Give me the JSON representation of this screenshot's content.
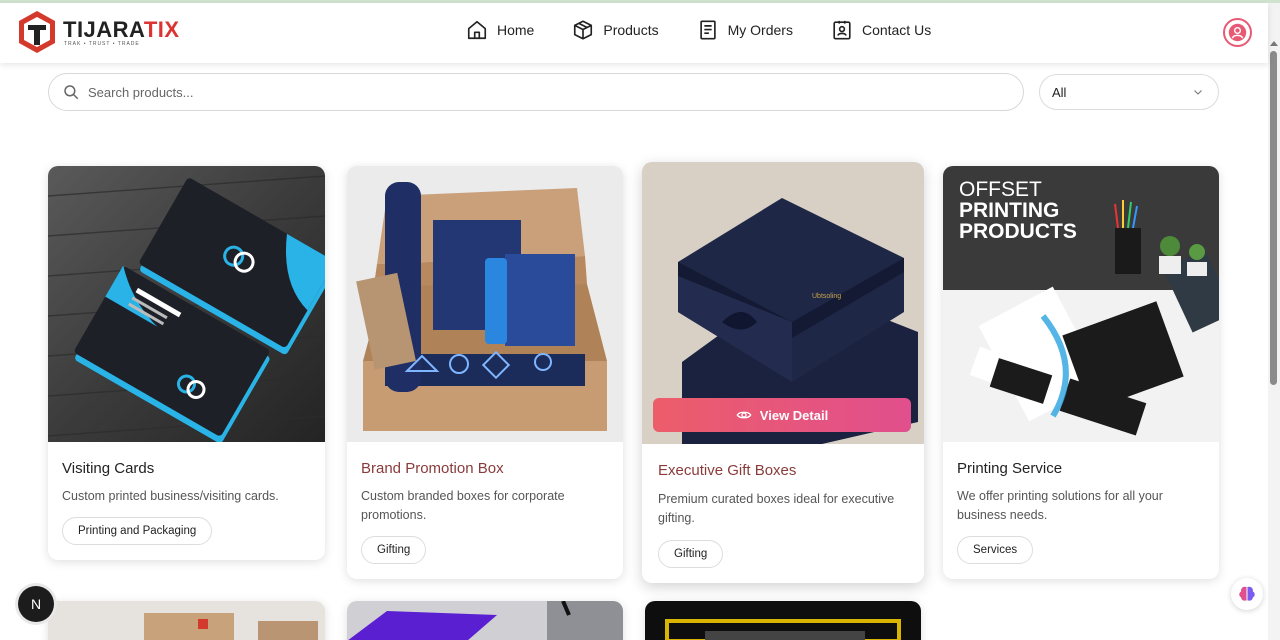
{
  "brand": {
    "name_main": "TIJARA",
    "name_accent": "TIX",
    "tagline": "TRAK • TRUST • TRADE"
  },
  "nav": [
    {
      "label": "Home",
      "icon": "home-icon"
    },
    {
      "label": "Products",
      "icon": "box-icon"
    },
    {
      "label": "My Orders",
      "icon": "document-icon"
    },
    {
      "label": "Contact Us",
      "icon": "contact-card-icon"
    }
  ],
  "search": {
    "placeholder": "Search products...",
    "value": ""
  },
  "filter": {
    "selected": "All"
  },
  "products": [
    {
      "title": "Visiting Cards",
      "description": "Custom printed business/visiting cards.",
      "category": "Printing and Packaging"
    },
    {
      "title": "Brand Promotion Box",
      "description": "Custom branded boxes for corporate promotions.",
      "category": "Gifting"
    },
    {
      "title": "Executive Gift Boxes",
      "description": "Premium curated boxes ideal for executive gifting.",
      "category": "Gifting",
      "action": "View Detail"
    },
    {
      "title": "Printing Service",
      "description": "We offer printing solutions for all your business needs.",
      "category": "Services",
      "image_text": [
        "OFFSET",
        "PRINTING",
        "PRODUCTS"
      ]
    }
  ],
  "floating": {
    "dev_badge": "N"
  },
  "colors": {
    "accent": "#e85a73",
    "brand_red": "#d33a2c",
    "highlight_title": "#8a3b3b"
  }
}
